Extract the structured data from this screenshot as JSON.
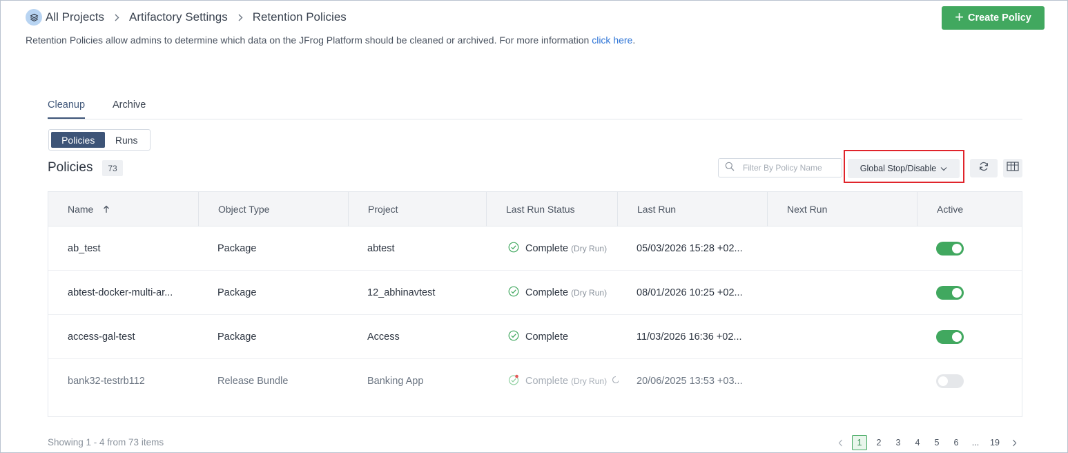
{
  "breadcrumb": {
    "items": [
      "All Projects",
      "Artifactory Settings",
      "Retention Policies"
    ]
  },
  "description": {
    "text": "Retention Policies allow admins to determine which data on the JFrog Platform should be cleaned or archived. For more information ",
    "link": "click here",
    "end": "."
  },
  "create_button": {
    "label": "Create Policy",
    "color": "#41a85f"
  },
  "tabs": [
    {
      "label": "Cleanup",
      "active": true
    },
    {
      "label": "Archive",
      "active": false
    }
  ],
  "segment": [
    {
      "label": "Policies",
      "active": true
    },
    {
      "label": "Runs",
      "active": false
    }
  ],
  "policies": {
    "title": "Policies",
    "count": "73",
    "filter_placeholder": "Filter By Policy Name",
    "global_button": "Global Stop/Disable"
  },
  "table": {
    "columns": [
      "Name",
      "Object Type",
      "Project",
      "Last Run Status",
      "Last Run",
      "Next Run",
      "Active"
    ],
    "rows": [
      {
        "name": "ab_test",
        "object_type": "Package",
        "project": "abtest",
        "status": "Complete",
        "status_note": "(Dry Run)",
        "last_run": "05/03/2026 15:28 +02...",
        "next_run": "",
        "active": true
      },
      {
        "name": "abtest-docker-multi-ar...",
        "object_type": "Package",
        "project": "12_abhinavtest",
        "status": "Complete",
        "status_note": "(Dry Run)",
        "last_run": "08/01/2026 10:25 +02...",
        "next_run": "",
        "active": true
      },
      {
        "name": "access-gal-test",
        "object_type": "Package",
        "project": "Access",
        "status": "Complete",
        "status_note": "",
        "last_run": "11/03/2026 16:36 +02...",
        "next_run": "",
        "active": true
      },
      {
        "name": "bank32-testrb112",
        "object_type": "Release Bundle",
        "project": "Banking App",
        "status": "Complete",
        "status_note": "(Dry Run)",
        "last_run": "20/06/2025 13:53 +03...",
        "next_run": "",
        "active": false
      }
    ]
  },
  "footer": {
    "showing": "Showing 1 - 4 from 73 items",
    "pages": [
      "1",
      "2",
      "3",
      "4",
      "5",
      "6",
      "...",
      "19"
    ],
    "current_page": "1"
  },
  "colors": {
    "accent": "#3d5477",
    "success": "#41a85f",
    "highlight": "#e0242b",
    "link": "#2f75d6"
  }
}
